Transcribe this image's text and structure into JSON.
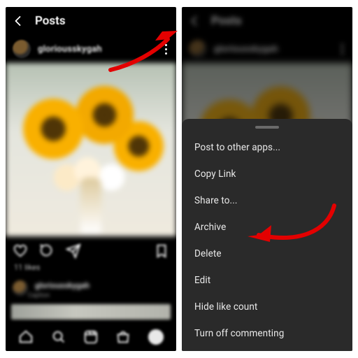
{
  "header": {
    "title": "Posts"
  },
  "post": {
    "username": "gloriousskygah",
    "likes_text": "11 likes",
    "caption_label": "Caption"
  },
  "sheet": {
    "items": [
      "Post to other apps...",
      "Copy Link",
      "Share to...",
      "Archive",
      "Delete",
      "Edit",
      "Hide like count",
      "Turn off commenting"
    ]
  }
}
